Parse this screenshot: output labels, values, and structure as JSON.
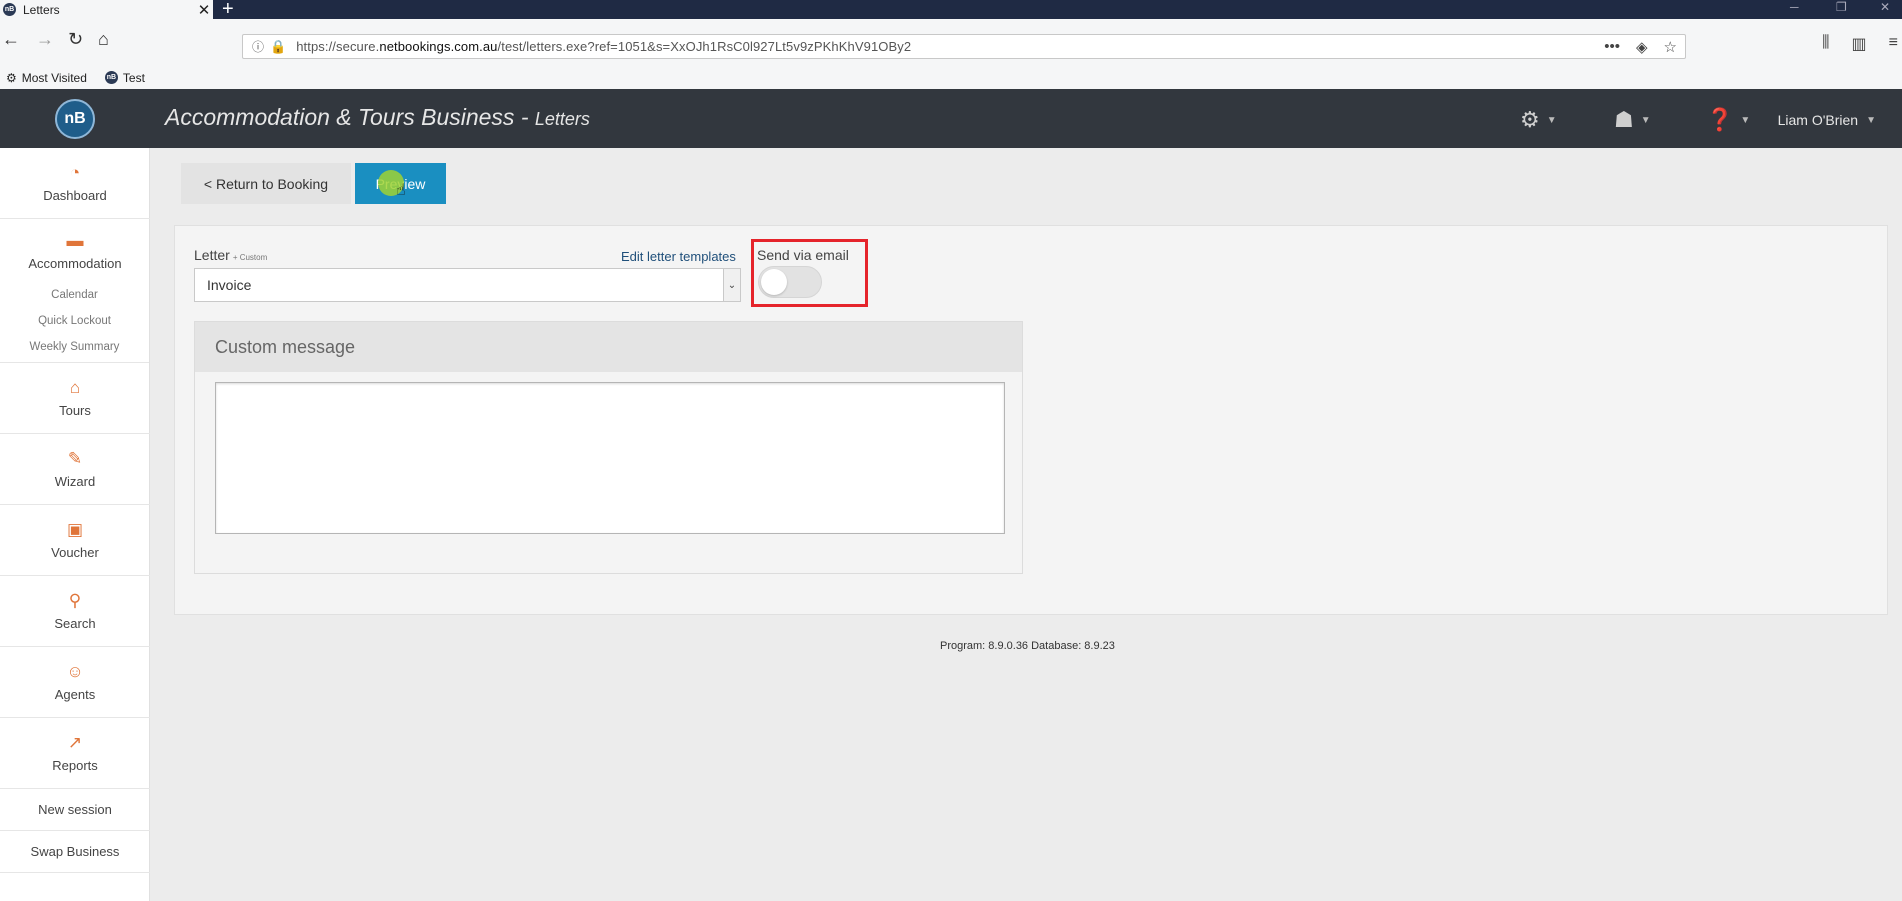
{
  "browser": {
    "tab_title": "Letters",
    "tab_close": "✕",
    "new_tab": "+",
    "url_host_prefix": "https://secure.",
    "url_host_main": "netbookings.com.au",
    "url_path": "/test/letters.exe?ref=1051&s=XxOJh1RsC0l927Lt5v9zPKhKhV91OBy2",
    "bookmarks": [
      {
        "label": "Most Visited"
      },
      {
        "label": "Test"
      }
    ]
  },
  "app": {
    "logo_text": "nB",
    "title": "Accommodation & Tours Business - ",
    "subtitle": "Letters",
    "user_name": "Liam O'Brien"
  },
  "sidebar": {
    "dashboard": "Dashboard",
    "accommodation": "Accommodation",
    "accommodation_sub": [
      "Calendar",
      "Quick Lockout",
      "Weekly Summary"
    ],
    "tours": "Tours",
    "wizard": "Wizard",
    "voucher": "Voucher",
    "search": "Search",
    "agents": "Agents",
    "reports": "Reports",
    "new_session": "New session",
    "swap_business": "Swap Business"
  },
  "toolbar": {
    "return_label": "< Return to Booking",
    "preview_label": "Preview"
  },
  "form": {
    "letter_label": "Letter",
    "letter_custom": "+ Custom",
    "edit_templates": "Edit letter templates",
    "letter_value": "Invoice",
    "send_email_label": "Send via email",
    "send_email_on": false,
    "custom_message_title": "Custom message",
    "custom_message_value": ""
  },
  "footer": {
    "version": "Program: 8.9.0.36 Database: 8.9.23"
  },
  "colors": {
    "header_bg": "#32373e",
    "accent_blue": "#1a8fc1",
    "icon_orange": "#e0753a",
    "highlight_red": "#e5242b"
  }
}
